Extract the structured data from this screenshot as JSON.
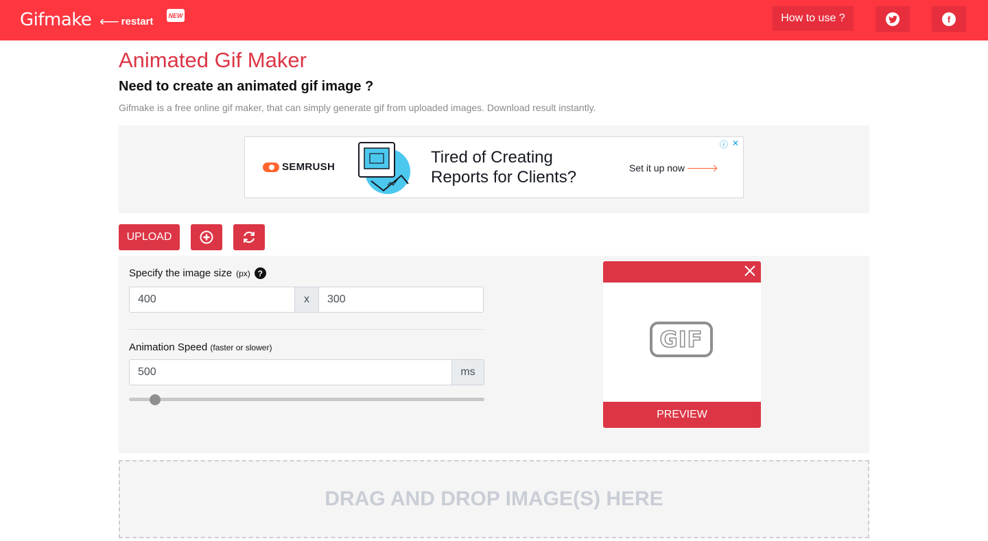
{
  "header": {
    "brand": "Gifmake",
    "restart_label": "restart",
    "new_badge": "NEW",
    "how_to_label": "How to use ?",
    "twitter_icon": "twitter-icon",
    "facebook_icon": "facebook-icon",
    "bg_color": "#fd3640"
  },
  "page": {
    "title": "Animated Gif Maker",
    "subtitle": "Need to create an animated gif image ?",
    "description": "Gifmake is a free online gif maker, that can simply generate gif from uploaded images. Download result instantly."
  },
  "ad": {
    "brand": "SEMRUSH",
    "headline_line1": "Tired of Creating",
    "headline_line2": "Reports for Clients?",
    "cta": "Set it up now"
  },
  "toolbar": {
    "upload_label": "UPLOAD",
    "add_icon": "plus-circle-icon",
    "refresh_icon": "refresh-icon",
    "accent_color": "#dc3545"
  },
  "settings": {
    "size_label": "Specify the image size",
    "size_unit": "(px)",
    "width": "400",
    "separator": "x",
    "height": "300",
    "speed_label": "Animation Speed",
    "speed_hint": "(faster or slower)",
    "speed_value": "500",
    "speed_unit": "ms",
    "speed_slider_fraction": 0.06
  },
  "preview": {
    "badge": "GIF",
    "button_label": "PREVIEW"
  },
  "dropzone": {
    "label": "DRAG AND DROP IMAGE(S) HERE"
  }
}
